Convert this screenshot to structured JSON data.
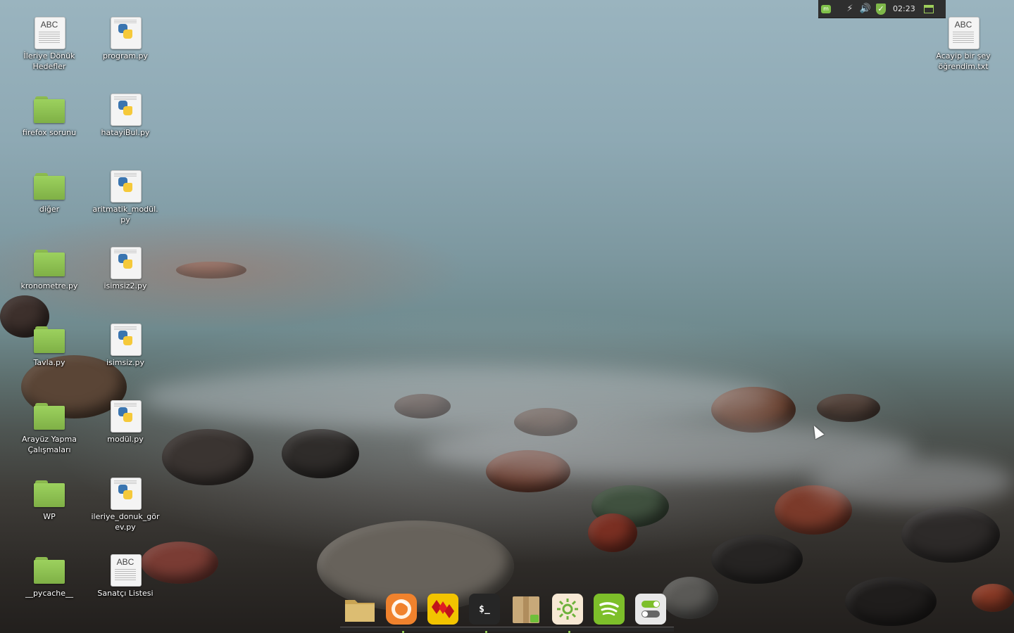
{
  "tray": {
    "clock": "02:23",
    "icons": [
      "mint-menu-icon",
      "network-icon",
      "volume-icon",
      "update-shield-icon",
      "show-desktop-icon"
    ]
  },
  "desktop_icons": {
    "col1": [
      {
        "label": "İleriye Dönük Hedefler",
        "type": "text-document"
      },
      {
        "label": "firefox sorunu",
        "type": "folder"
      },
      {
        "label": "diğer",
        "type": "folder"
      },
      {
        "label": "kronometre.py",
        "type": "folder"
      },
      {
        "label": "Tavla.py",
        "type": "folder"
      },
      {
        "label": "Arayüz Yapma Çalışmaları",
        "type": "folder"
      },
      {
        "label": "WP",
        "type": "folder"
      },
      {
        "label": "__pycache__",
        "type": "folder"
      }
    ],
    "col2": [
      {
        "label": "program.py",
        "type": "python"
      },
      {
        "label": "hatayiBul.py",
        "type": "python"
      },
      {
        "label": "aritmatik_modül.py",
        "type": "python"
      },
      {
        "label": "isimsiz2.py",
        "type": "python"
      },
      {
        "label": "isimsiz.py",
        "type": "python"
      },
      {
        "label": "modül.py",
        "type": "python"
      },
      {
        "label": "ileriye_donuk_görev.py",
        "type": "python"
      },
      {
        "label": "Sanatçı Listesi",
        "type": "text-document"
      }
    ],
    "right": [
      {
        "label": "Acayip bir şey öğrendim.txt",
        "type": "text-document"
      }
    ]
  },
  "doc_glyph": "ABC",
  "dock": {
    "items": [
      {
        "name": "files-folder-icon",
        "color": "#d9b86a"
      },
      {
        "name": "firefox-icon",
        "color": "#f0822d"
      },
      {
        "name": "solitaire-cards-icon",
        "color": "#f2c400"
      },
      {
        "name": "terminal-icon",
        "color": "#2b2b2b",
        "glyph": "$_"
      },
      {
        "name": "archive-package-icon",
        "color": "#c8a979"
      },
      {
        "name": "brightness-sun-icon",
        "color": "#f7e8d4"
      },
      {
        "name": "spotify-icon",
        "color": "#7dbf2a"
      },
      {
        "name": "settings-toggle-icon",
        "color": "#e8e8e8"
      }
    ]
  }
}
